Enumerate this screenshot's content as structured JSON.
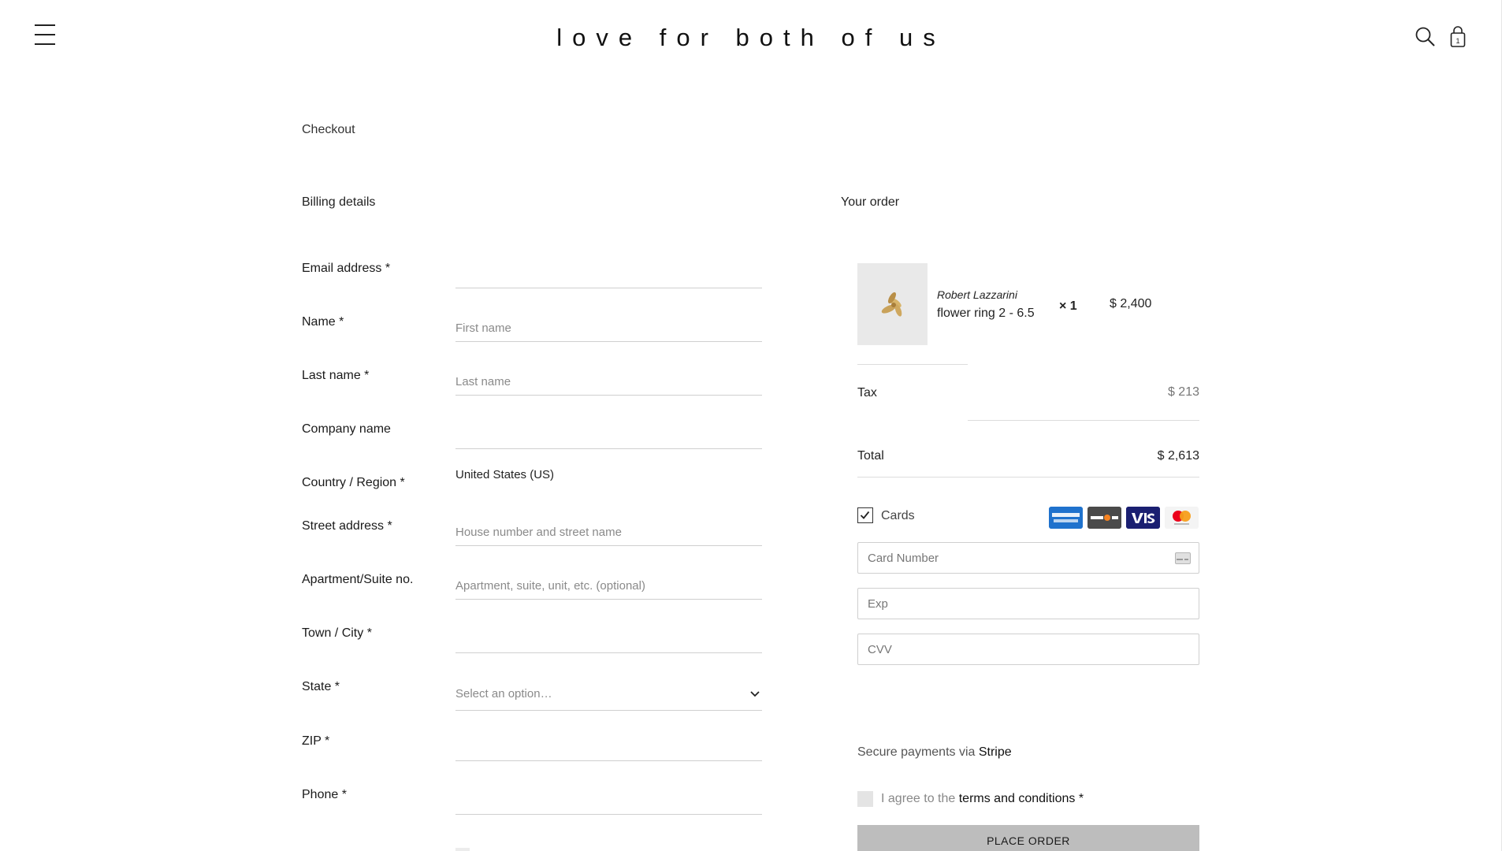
{
  "header": {
    "logo": "love for both of us",
    "menu_icon": "hamburger-menu-icon",
    "search_icon": "search-icon",
    "bag_icon": "shopping-bag-icon",
    "bag_count": "1"
  },
  "page": {
    "title": "Checkout"
  },
  "billing": {
    "heading": "Billing details",
    "fields": {
      "email": {
        "label": "Email address *",
        "value": "",
        "placeholder": ""
      },
      "first_name": {
        "label": "Name *",
        "value": "",
        "placeholder": "First name"
      },
      "last_name": {
        "label": "Last name *",
        "value": "",
        "placeholder": "Last name"
      },
      "company": {
        "label": "Company name",
        "value": "",
        "placeholder": ""
      },
      "country": {
        "label": "Country / Region *",
        "value": "United States (US)"
      },
      "street": {
        "label": "Street address *",
        "value": "",
        "placeholder": "House number and street name"
      },
      "apartment": {
        "label": "Apartment/Suite no.",
        "value": "",
        "placeholder": "Apartment, suite, unit, etc. (optional)"
      },
      "city": {
        "label": "Town / City *",
        "value": "",
        "placeholder": ""
      },
      "state": {
        "label": "State *",
        "selected": "Select an option…"
      },
      "zip": {
        "label": "ZIP *",
        "value": "",
        "placeholder": ""
      },
      "phone": {
        "label": "Phone *",
        "value": "",
        "placeholder": ""
      }
    }
  },
  "order": {
    "heading": "Your order",
    "item": {
      "brand": "Robert Lazzarini",
      "name": "flower ring 2 - 6.5",
      "quantity": "× 1",
      "price": "$ 2,400"
    },
    "tax_label": "Tax",
    "tax_value": "$ 213",
    "total_label": "Total",
    "total_value": "$ 2,613"
  },
  "payment": {
    "method_label": "Cards",
    "method_checked": true,
    "card_brands": [
      "amex-logo-icon",
      "discover-logo-icon",
      "visa-logo-icon",
      "mastercard-logo-icon"
    ],
    "card_number_placeholder": "Card Number",
    "exp_placeholder": "Exp",
    "cvv_placeholder": "CVV",
    "secure_prefix": "Secure payments via ",
    "secure_brand": "Stripe",
    "terms_prefix": "I agree to the ",
    "terms_link": "terms and conditions",
    "terms_suffix": " *",
    "place_order": "PLACE ORDER"
  },
  "colors": {
    "text": "#1a1a1a",
    "muted": "#8a8a8a",
    "divider": "#cfcfcf",
    "button": "#bdbdbd",
    "amex": "#1f72cd",
    "visa": "#1a1f71"
  }
}
